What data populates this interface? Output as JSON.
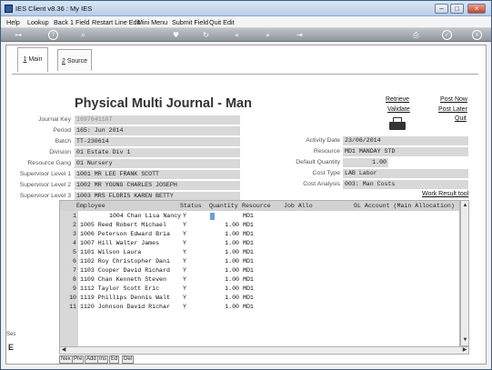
{
  "window": {
    "title": "IES Client v8.36 : My IES"
  },
  "menu": [
    "Help",
    "Lookup",
    "Back 1 Field",
    "Restart Line Edit",
    "Mini Menu",
    "Submit Field",
    "Quit Edit"
  ],
  "tabs": [
    {
      "key": "1",
      "rest": " Main"
    },
    {
      "key": "2",
      "rest": " Source"
    }
  ],
  "page_title": "Physical Multi Journal - Man",
  "actions": {
    "retrieve": "Retrieve",
    "validate": "Validate",
    "post_now": "Post Now",
    "post_later": "Post Later",
    "quit": "Quit"
  },
  "left_fields": [
    {
      "label": "Journal Key",
      "value": "1697641107",
      "muted": true
    },
    {
      "label": "Period",
      "value": "165: Jun 2014"
    },
    {
      "label": "Batch",
      "value": "TT-230614"
    },
    {
      "label": "Division",
      "value": "01 Estate Div 1"
    },
    {
      "label": "Resource Gang",
      "value": "01 Nursery"
    },
    {
      "label": "Supervisor Level 1",
      "value": "1001 MR LEE FRANK SCOTT"
    },
    {
      "label": "Supervisor Level 2",
      "value": "1002 MR YOUNG CHARLES JOSEPH"
    },
    {
      "label": "Supervisor Level 3",
      "value": "1003 MRS FLORIS KAREN BETTY"
    }
  ],
  "right_fields": [
    {
      "label": "Activity Date",
      "value": "23/06/2014"
    },
    {
      "label": "Resource",
      "value": "MD1 MANDAY STD"
    },
    {
      "label": "Default Quantity",
      "value": "1.00",
      "align": "right"
    },
    {
      "label": "Cost Type",
      "value": "LAB Labor"
    },
    {
      "label": "Cost Analysis",
      "value": "003: Man Costs"
    }
  ],
  "work_result_tool": "Work Result tool",
  "grid": {
    "headers": [
      "Employee",
      "Status",
      "Quantity",
      "Resource",
      "Job Allo",
      "GL Account (Main Allocation)"
    ],
    "rows": [
      {
        "n": "",
        "employee": "1004 Chan Lisa Nancy",
        "status": "Y",
        "quantity": "",
        "resource": "MD1"
      },
      {
        "n": "1",
        "employee": "1005 Reed Robert Michael",
        "status": "Y",
        "quantity": "1.00",
        "resource": "MD1"
      },
      {
        "n": "2",
        "employee": "1006 Peterson Edward Bria",
        "status": "Y",
        "quantity": "1.00",
        "resource": "MD1"
      },
      {
        "n": "3",
        "employee": "1007 Hill Walter James",
        "status": "Y",
        "quantity": "1.00",
        "resource": "MD1"
      },
      {
        "n": "4",
        "employee": "1101 Wilson Laura",
        "status": "Y",
        "quantity": "1.00",
        "resource": "MD1"
      },
      {
        "n": "5",
        "employee": "1102 Roy Christopher Dani",
        "status": "Y",
        "quantity": "1.00",
        "resource": "MD1"
      },
      {
        "n": "6",
        "employee": "1103 Cooper David Richard",
        "status": "Y",
        "quantity": "1.00",
        "resource": "MD1"
      },
      {
        "n": "7",
        "employee": "1109 Chan Kenneth Steven",
        "status": "Y",
        "quantity": "1.00",
        "resource": "MD1"
      },
      {
        "n": "8",
        "employee": "1112 Taylor Scott Eric",
        "status": "Y",
        "quantity": "1.00",
        "resource": "MD1"
      },
      {
        "n": "9",
        "employee": "1119 Phillips Dennis Walt",
        "status": "Y",
        "quantity": "1.00",
        "resource": "MD1"
      },
      {
        "n": "10",
        "employee": "1120 Johnson David Richar",
        "status": "Y",
        "quantity": "1.00",
        "resource": "MD1"
      }
    ],
    "row_numbers_display": [
      "1",
      "2",
      "3",
      "4",
      "5",
      "6",
      "7",
      "8",
      "9",
      "10",
      "11"
    ],
    "buttons": [
      "Nex",
      "Pre",
      "Add",
      "Ins",
      "Ed",
      "Del"
    ]
  },
  "side": {
    "tag": "Ses",
    "icon_letter": "E"
  },
  "colors": {
    "title_bar": "#c8d8ec",
    "toolbar": "#9aa0a6",
    "field_bg": "#d8d8d8",
    "active_cell": "#6a9fe0"
  }
}
